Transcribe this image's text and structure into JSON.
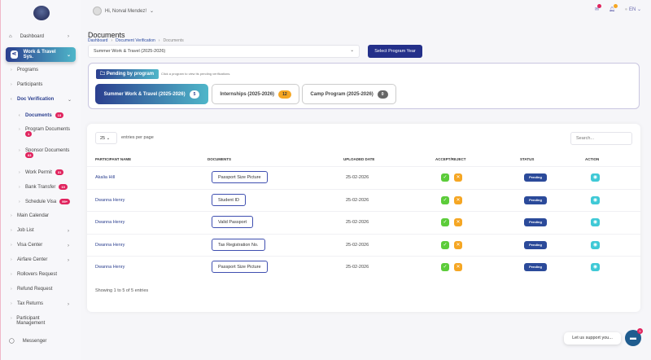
{
  "header": {
    "greeting": "Hi, Norval Mendez!",
    "language": "EN"
  },
  "sidebar": {
    "items": [
      {
        "label": "Dashboard"
      },
      {
        "label": "Work & Travel Sys."
      },
      {
        "label": "Programs"
      },
      {
        "label": "Participants"
      },
      {
        "label": "Doc Verification"
      },
      {
        "label": "Documents",
        "badge": "13"
      },
      {
        "label": "Program Documents",
        "badge": "1"
      },
      {
        "label": "Sponsor Documents",
        "badge": "63"
      },
      {
        "label": "Work Permit",
        "badge": "31"
      },
      {
        "label": "Bank Transfer",
        "badge": "10"
      },
      {
        "label": "Schedule Visa",
        "badge": "99+"
      },
      {
        "label": "Main Calendar"
      },
      {
        "label": "Job List"
      },
      {
        "label": "Visa Center"
      },
      {
        "label": "Airfare Center"
      },
      {
        "label": "Rollovers Request"
      },
      {
        "label": "Refund Request"
      },
      {
        "label": "Tax Returns"
      },
      {
        "label": "Participant Management"
      },
      {
        "label": "Messenger"
      }
    ]
  },
  "page": {
    "title": "Documents",
    "breadcrumb": [
      "Dashboard",
      "Document Verification",
      "Documents"
    ],
    "program_select": "Summer Work & Travel (2025-2026)",
    "select_year": "Select Program Year"
  },
  "pending": {
    "tag": "Pending by program",
    "hint": "Click a program to view its pending verifications.",
    "programs": [
      {
        "name": "Summer Work & Travel (2025-2026)",
        "count": "5"
      },
      {
        "name": "Internships (2025-2026)",
        "count": "12"
      },
      {
        "name": "Camp Program (2025-2026)",
        "count": "0"
      }
    ]
  },
  "table": {
    "per_page": "25",
    "per_page_label": "entries per page",
    "search_placeholder": "Search...",
    "columns": [
      "PARTICIPANT NAME",
      "DOCUMENTS",
      "UPLOADED DATE",
      "ACCEPT/REJECT",
      "STATUS",
      "ACTION"
    ],
    "rows": [
      {
        "name": "Akalia Hill",
        "document": "Passport Size Picture",
        "date": "25-02-2026",
        "status": "Pending"
      },
      {
        "name": "Dwanna Henry",
        "document": "Student ID",
        "date": "25-02-2026",
        "status": "Pending"
      },
      {
        "name": "Dwanna Henry",
        "document": "Valid Passport",
        "date": "25-02-2026",
        "status": "Pending"
      },
      {
        "name": "Dwanna Henry",
        "document": "Tax Registration No.",
        "date": "25-02-2026",
        "status": "Pending"
      },
      {
        "name": "Dwanna Henry",
        "document": "Passport Size Picture",
        "date": "25-02-2026",
        "status": "Pending"
      }
    ],
    "footer": "Showing 1 to 5 of 5 entries"
  },
  "support": {
    "text": "Let us support you...",
    "badge": "5"
  },
  "colors": {
    "accent": "#24308a",
    "gradient_end": "#4fb6c9",
    "badge": "#e0245e"
  }
}
